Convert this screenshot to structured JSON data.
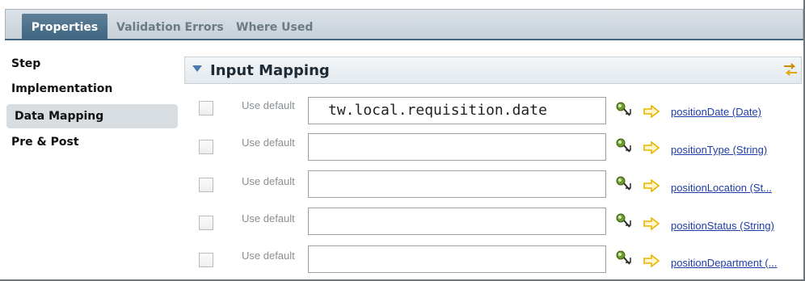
{
  "tabs": [
    {
      "label": "Properties"
    },
    {
      "label": "Validation Errors"
    },
    {
      "label": "Where Used"
    }
  ],
  "nav": {
    "items": [
      {
        "label": "Step"
      },
      {
        "label": "Implementation"
      },
      {
        "label": "Data Mapping"
      },
      {
        "label": "Pre & Post"
      }
    ]
  },
  "section": {
    "title": "Input Mapping"
  },
  "rows": [
    {
      "use_default_label": "Use default",
      "value": "tw.local.requisition.date",
      "target": "positionDate (Date)"
    },
    {
      "use_default_label": "Use default",
      "value": "",
      "target": "positionType (String)"
    },
    {
      "use_default_label": "Use default",
      "value": "",
      "target": "positionLocation (St..."
    },
    {
      "use_default_label": "Use default",
      "value": "",
      "target": "positionStatus (String)"
    },
    {
      "use_default_label": "Use default",
      "value": "",
      "target": "positionDepartment (..."
    }
  ],
  "colors": {
    "active_tab": "#4a6f8b",
    "link": "#1f3da8",
    "arrow": "#e8b400"
  },
  "icons": {
    "section_toggle": "chevron-down-icon",
    "sync": "sync-arrows-icon",
    "variable_picker": "variable-picker-icon",
    "mapping_arrow": "right-arrow-icon"
  }
}
